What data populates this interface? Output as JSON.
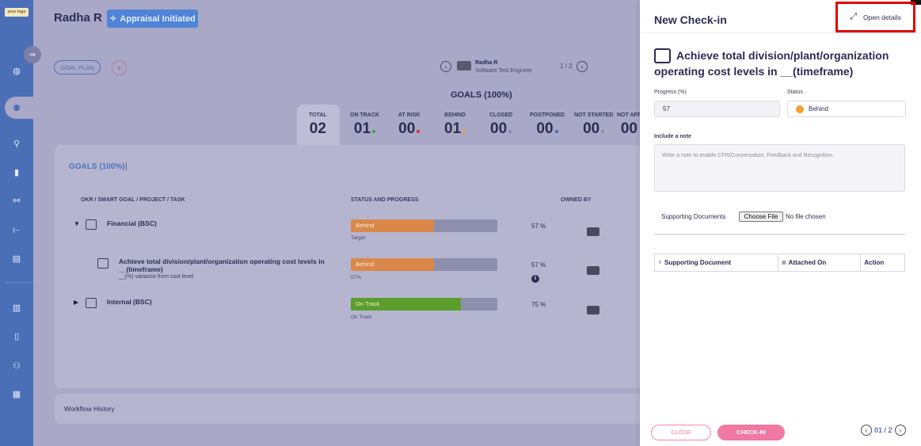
{
  "logo": {
    "text": "your logo"
  },
  "sidebar": {
    "icons": [
      "globe-icon",
      "team-icon",
      "person-flow-icon",
      "book-icon",
      "handshake-icon",
      "org-chart-icon",
      "form-icon",
      "report-icon",
      "book-icon",
      "people-icon",
      "chart-icon"
    ]
  },
  "header": {
    "user_name": "Radha R",
    "appraisal_status": "Appraisal Initiated",
    "goal_plan_label": "GOAL PLAN",
    "add_label": "+"
  },
  "employee": {
    "name": "Radha R",
    "role": "Software Test Engineer",
    "page": "1 / 2"
  },
  "goals": {
    "heading": "GOALS (100%)",
    "stats": [
      {
        "label": "TOTAL",
        "value": "02"
      },
      {
        "label": "ON TRACK",
        "value": "01",
        "dot": "#2eaa4e"
      },
      {
        "label": "AT RISK",
        "value": "00",
        "dot": "#e02e2e"
      },
      {
        "label": "BEHIND",
        "value": "01",
        "dot": "#f5a12d"
      },
      {
        "label": "CLOSED",
        "value": "00",
        "dot": "#8b8ca2"
      },
      {
        "label": "POSTPONED",
        "value": "00",
        "dot": "#3a6fd0"
      },
      {
        "label": "NOT STARTED",
        "value": "00",
        "dot": "#8b8ca2"
      },
      {
        "label": "NOT APP",
        "value": "00"
      }
    ]
  },
  "panel": {
    "tab_label": "GOALS (100%)",
    "tab_sep": "|",
    "columns": {
      "okr": "OKR / SMART GOAL / PROJECT / TASK",
      "status": "STATUS AND PROGRESS",
      "owned": "OWNED BY"
    },
    "rows": [
      {
        "title": "Financial (BSC)",
        "status": "Behind",
        "progress": 57,
        "sub": "Target",
        "pct": "57  %",
        "color": "#d9884a"
      },
      {
        "title": "Achieve total division/plant/organization operating cost levels in __(timeframe)",
        "desc": "__(%) variance from cost level",
        "status": "Behind",
        "progress": 57,
        "sub": "57%",
        "pct": "57  %",
        "color": "#d9884a"
      },
      {
        "title": "Internal (BSC)",
        "status": "On Track",
        "progress": 75,
        "sub": "On Track",
        "pct": "75  %",
        "color": "#5b9e2c"
      }
    ]
  },
  "workflow": {
    "label": "Workflow History"
  },
  "drawer": {
    "title": "New Check-in",
    "open_details": "Open details",
    "goal_title": "Achieve total division/plant/organization operating cost levels in __(timeframe)",
    "progress_label": "Progress (%)",
    "progress_value": "57",
    "status_label": "Status",
    "status_value": "Behind",
    "note_label": "Include a note",
    "note_placeholder": "Write a note to enable CFR(Conversation, Feedback and Recognition.",
    "sd_label": "Supporting Documents",
    "choose_file": "Choose File",
    "no_file": "No file chosen",
    "table_headers": [
      "Supporting Document",
      "Attached On",
      "Action"
    ],
    "close_label": "CLOSE",
    "checkin_label": "CHECK-IN",
    "page_current": "01",
    "page_total": "/ 2"
  }
}
